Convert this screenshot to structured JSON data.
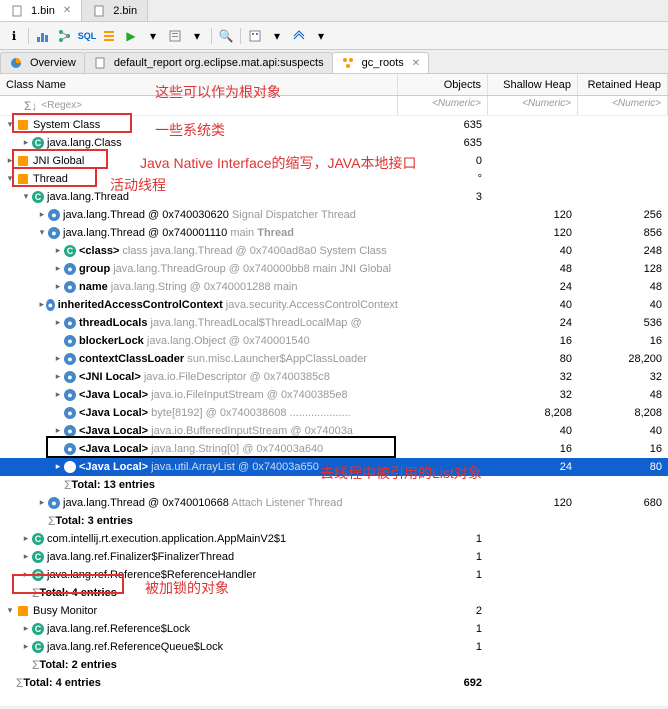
{
  "editorTabs": {
    "t1": "1.bin",
    "t2": "2.bin"
  },
  "viewTabs": {
    "ov": "Overview",
    "dr": "default_report  org.eclipse.mat.api:suspects",
    "gc": "gc_roots"
  },
  "cols": {
    "name": "Class Name",
    "obj": "Objects",
    "sh": "Shallow Heap",
    "ret": "Retained Heap"
  },
  "filter": {
    "regex": "<Regex>",
    "num": "<Numeric>"
  },
  "rows": {
    "sysClass": "System Class",
    "javaLangClass": "java.lang.Class",
    "jniGlobal": "JNI Global",
    "thread": "Thread",
    "javaLangThread": "java.lang.Thread",
    "t1": {
      "a": "java.lang.Thread @ 0x740030620",
      "b": "  Signal Dispatcher  ",
      "c": "Thread"
    },
    "t2": {
      "a": "java.lang.Thread @ 0x740001110",
      "b": "  main  ",
      "c": "Thread"
    },
    "cls": {
      "a": "<class>",
      "b": " class java.lang.Thread @ 0x7400ad8a0  ",
      "c": "System Class"
    },
    "grp": {
      "a": "group",
      "b": " java.lang.ThreadGroup @ 0x740000bb8  main  ",
      "c": "JNI Global"
    },
    "nm": {
      "a": "name",
      "b": " java.lang.String @ 0x740001288  ",
      "c": "main"
    },
    "iacc": {
      "a": "inheritedAccessControlContext",
      "b": " java.security.AccessControlContext"
    },
    "tloc": {
      "a": "threadLocals",
      "b": " java.lang.ThreadLocal$ThreadLocalMap @"
    },
    "blk": {
      "a": "blockerLock",
      "b": " java.lang.Object @ 0x740001540"
    },
    "ccl": {
      "a": "contextClassLoader",
      "b": " sun.misc.Launcher$AppClassLoader"
    },
    "jl1": {
      "a": "<JNI Local>",
      "b": " java.io.FileDescriptor @ 0x7400385c8"
    },
    "jl2": {
      "a": "<Java Local>",
      "b": " java.io.FileInputStream @ 0x7400385e8"
    },
    "jl3": {
      "a": "<Java Local>",
      "b": " byte[8192] @ 0x740038608  ...................."
    },
    "jl4": {
      "a": "<Java Local>",
      "b": " java.io.BufferedInputStream @ 0x74003a"
    },
    "jl5": {
      "a": "<Java Local>",
      "b": " java.lang.String[0] @ 0x74003a640"
    },
    "jl6": {
      "a": "<Java Local>",
      "b": " java.util.ArrayList @ 0x74003a650"
    },
    "tot13": "Total: 13 entries",
    "t3": {
      "a": "java.lang.Thread @ 0x740010668",
      "b": "  Attach Listener  ",
      "c": "Thread"
    },
    "tot3": "Total: 3 entries",
    "appMain": "com.intellij.rt.execution.application.AppMainV2$1",
    "finThread": "java.lang.ref.Finalizer$FinalizerThread",
    "refHandler": "java.lang.ref.Reference$ReferenceHandler",
    "tot4a": "Total: 4 entries",
    "busyMon": "Busy Monitor",
    "refLock": "java.lang.ref.Reference$Lock",
    "refQLock": "java.lang.ref.ReferenceQueue$Lock",
    "tot2": "Total: 2 entries",
    "tot4b": "Total: 4 entries"
  },
  "vals": {
    "sysClass": {
      "o": "635"
    },
    "javaLangClass": {
      "o": "635"
    },
    "jniGlobal": {
      "o": "0"
    },
    "thread": {
      "o": "°"
    },
    "javaLangThread": {
      "o": "3"
    },
    "t1": {
      "o": "",
      "s": "120",
      "r": "256"
    },
    "t2": {
      "o": "",
      "s": "120",
      "r": "856"
    },
    "cls": {
      "o": "",
      "s": "40",
      "r": "248"
    },
    "grp": {
      "o": "",
      "s": "48",
      "r": "128"
    },
    "nm": {
      "o": "",
      "s": "24",
      "r": "48"
    },
    "iacc": {
      "o": "",
      "s": "40",
      "r": "40"
    },
    "tloc": {
      "o": "",
      "s": "24",
      "r": "536"
    },
    "blk": {
      "o": "",
      "s": "16",
      "r": "16"
    },
    "ccl": {
      "o": "",
      "s": "80",
      "r": "28,200"
    },
    "jl1": {
      "o": "",
      "s": "32",
      "r": "32"
    },
    "jl2": {
      "o": "",
      "s": "32",
      "r": "48"
    },
    "jl3": {
      "o": "",
      "s": "8,208",
      "r": "8,208"
    },
    "jl4": {
      "o": "",
      "s": "40",
      "r": "40"
    },
    "jl5": {
      "o": "",
      "s": "16",
      "r": "16"
    },
    "jl6": {
      "o": "",
      "s": "24",
      "r": "80"
    },
    "t3": {
      "o": "",
      "s": "120",
      "r": "680"
    },
    "appMain": {
      "o": "1"
    },
    "finThread": {
      "o": "1"
    },
    "refHandler": {
      "o": "1"
    },
    "busyMon": {
      "o": "2"
    },
    "refLock": {
      "o": "1"
    },
    "refQLock": {
      "o": "1"
    },
    "tot4b": {
      "o": "692"
    }
  },
  "annotations": {
    "a1": "这些可以作为根对象",
    "a2": "一些系统类",
    "a3": "Java Native Interface的缩写，JAVA本地接口",
    "a4": "活动线程",
    "a5": "去线程中被引用的List对象",
    "a6": "被加锁的对象"
  }
}
